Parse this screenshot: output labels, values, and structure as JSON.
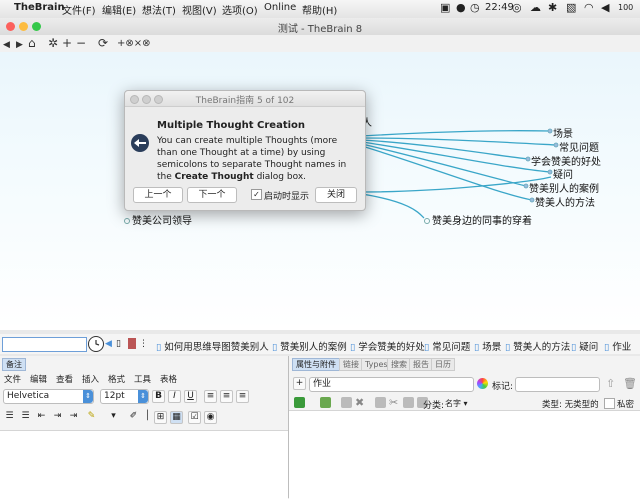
{
  "menubar": {
    "app": "TheBrain",
    "items": [
      "文件(F)",
      "编辑(E)",
      "想法(T)",
      "视图(V)",
      "选项(O)",
      "Online",
      "帮助(H)"
    ],
    "time": "22:49",
    "battery": "100"
  },
  "window": {
    "title": "测试 - TheBrain 8"
  },
  "toolbar": {
    "back": "◀",
    "forward": "▶",
    "home": "⌂",
    "star": "✲",
    "plus": "+",
    "minus": "−",
    "refresh": "⟳",
    "link_tools": "+⊗×⊗"
  },
  "canvas": {
    "children": [
      "场景",
      "常见问题",
      "学会赞美的好处",
      "疑问",
      "赞美别人的案例",
      "赞美人的方法"
    ],
    "left_node": "赞美公司领导",
    "bottom_node": "赞美身边的同事的穿着",
    "partial_node": "人"
  },
  "dialog": {
    "title": "TheBrain指南 5 of 102",
    "heading": "Multiple Thought Creation",
    "body_part1": "You can create multiple Thoughts (more than one Thought at a time) by using semicolons to separate Thought names in the ",
    "body_bold": "Create Thought",
    "body_part2": " dialog box.",
    "prev": "上一个",
    "next": "下一个",
    "show_on_startup": "启动时显示",
    "close": "关闭"
  },
  "pathbar": {
    "input_value": "",
    "crumbs": [
      "如何用思维导图赞美别人",
      "赞美别人的案例",
      "学会赞美的好处",
      "常见问题",
      "场景",
      "赞美人的方法",
      "疑问",
      "作业"
    ]
  },
  "notes": {
    "tab": "备注",
    "menu": [
      "文件",
      "编辑",
      "查看",
      "插入",
      "格式",
      "工具",
      "表格"
    ],
    "font": "Helvetica",
    "size": "12pt",
    "bold": "B",
    "italic": "I",
    "underline": "U"
  },
  "properties": {
    "tabs": [
      "属性与附件",
      "链接",
      "Types",
      "搜索",
      "报告",
      "日历"
    ],
    "name_value": "作业",
    "tag_label": "标记:",
    "sort_label": "分类:",
    "sort_value": "名字",
    "type_label": "类型: 无类型的",
    "private_label": "私密"
  },
  "colors": {
    "accent": "#4a90d9",
    "link_line": "#3aa6c8",
    "canvas_top": "#eaf6fc"
  }
}
